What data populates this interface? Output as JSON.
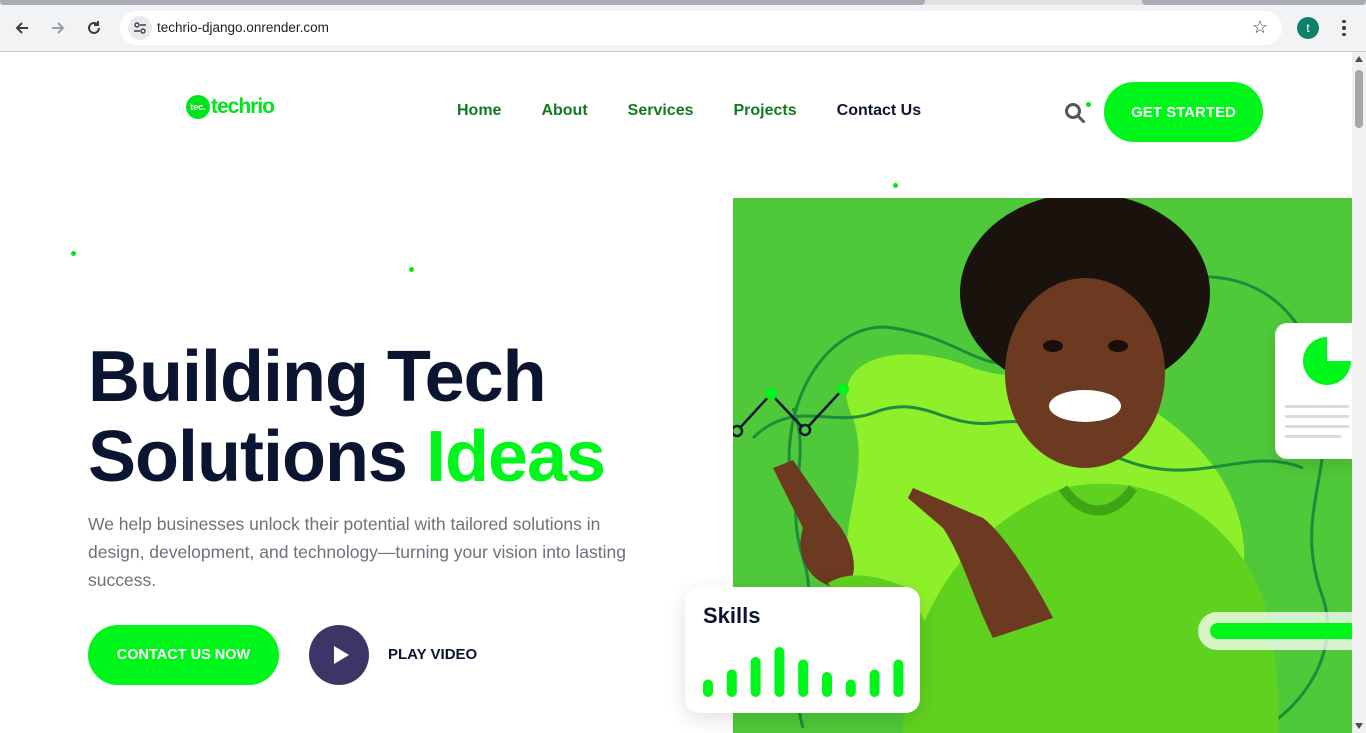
{
  "browser": {
    "url": "techrio-django.onrender.com",
    "profile_initial": "t"
  },
  "logo": {
    "mark_text": "tec.",
    "word": "techrio"
  },
  "nav": {
    "items": [
      {
        "label": "Home"
      },
      {
        "label": "About"
      },
      {
        "label": "Services"
      },
      {
        "label": "Projects"
      },
      {
        "label": "Contact Us"
      }
    ]
  },
  "header": {
    "cta_label": "GET STARTED"
  },
  "hero": {
    "headline_line1": "Building Tech",
    "headline_line2_prefix": "Solutions ",
    "headline_accent": "Ideas",
    "description": "We help businesses unlock their potential with tailored solutions in design, development, and technology—turning your vision into lasting success.",
    "contact_button": "CONTACT US NOW",
    "play_label": "PLAY VIDEO"
  },
  "skills_card": {
    "title": "Skills",
    "bar_levels": [
      0.35,
      0.55,
      0.8,
      1.0,
      0.75,
      0.5,
      0.35,
      0.55,
      0.75
    ]
  },
  "colors": {
    "accent": "#00f51a",
    "dark": "#0b1430",
    "nav_green": "#107a1e",
    "play": "#3d3566"
  }
}
